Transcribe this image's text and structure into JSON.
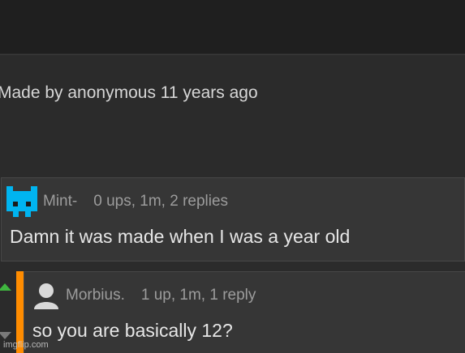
{
  "post": {
    "meta": "Made by anonymous 11 years ago"
  },
  "comments": [
    {
      "username": "Mint-",
      "stats": "0 ups, 1m, 2 replies",
      "text": "Damn it was made when I was a year old",
      "avatar_icon": "cyan-cat-avatar-icon",
      "avatar_color": "#00b4f0"
    },
    {
      "username": "Morbius.",
      "stats": "1 up, 1m, 1 reply",
      "text": "so you are basically 12?",
      "avatar_icon": "default-user-avatar-icon",
      "accent_color": "#ff8c00"
    }
  ],
  "votes": {
    "upvote_color": "#3fb63f",
    "downvote_color": "#7a7a7a"
  },
  "watermark": "imgflip.com"
}
